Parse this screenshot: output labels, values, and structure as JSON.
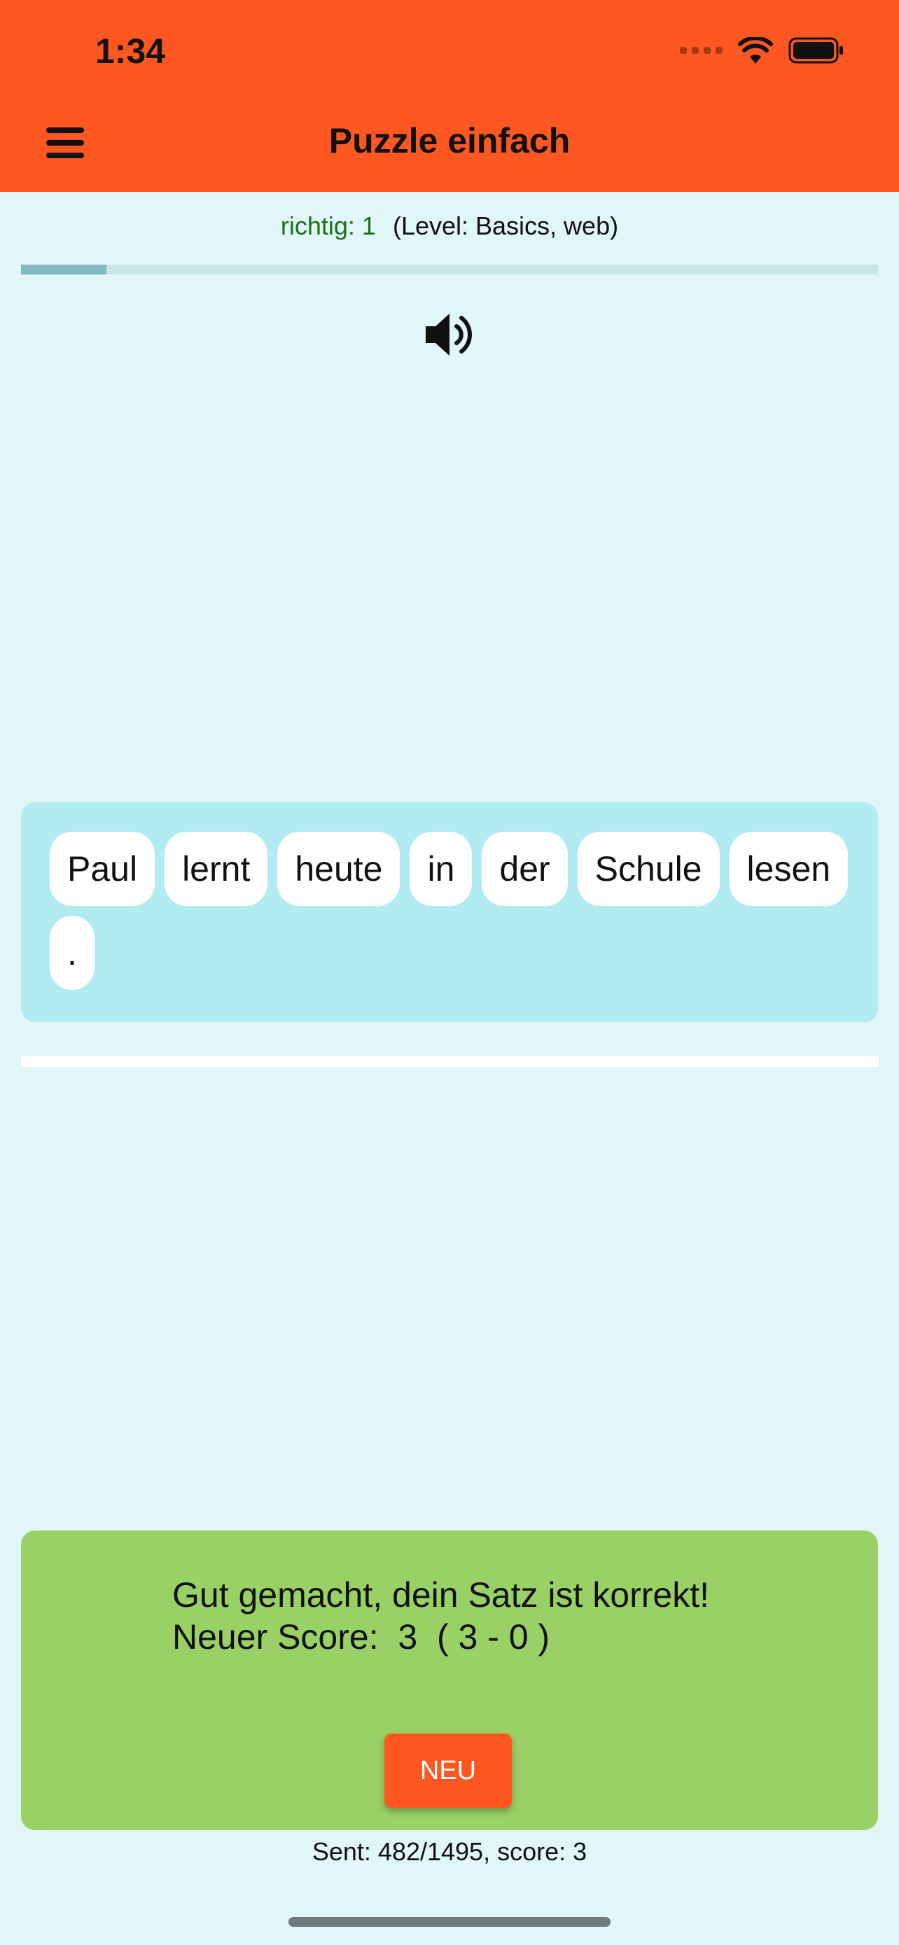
{
  "status_bar": {
    "time": "1:34"
  },
  "header": {
    "title": "Puzzle einfach"
  },
  "stats": {
    "correct": "richtig: 1",
    "level": "(Level: Basics, web)",
    "progress_fraction": 0.1
  },
  "words": [
    "Paul",
    "lernt",
    "heute",
    "in",
    "der",
    "Schule",
    "lesen",
    "."
  ],
  "feedback": {
    "line1": "Gut gemacht, dein Satz ist korrekt!",
    "line2": "Neuer Score:  3  ( 3 - 0 )",
    "button_label": "NEU"
  },
  "footer": {
    "stats": "Sent: 482/1495, score: 3"
  },
  "icons": {
    "menu": "hamburger-menu-icon",
    "speaker": "speaker-volume-icon",
    "wifi": "wifi-icon",
    "battery": "battery-icon"
  },
  "colors": {
    "brand": "#ff5722",
    "background": "#e0f6f7",
    "word_area": "#b3ebf2",
    "success": "#9ad166"
  }
}
